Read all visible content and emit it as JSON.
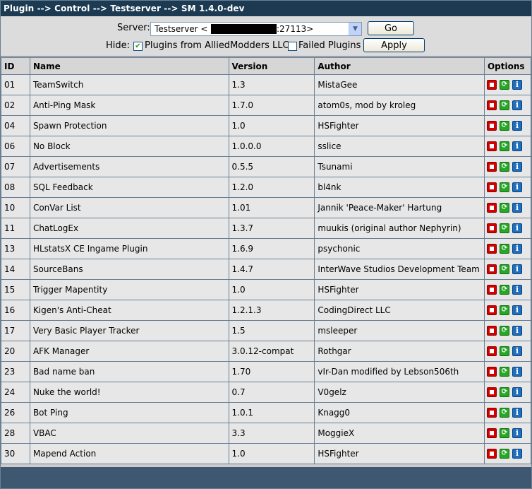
{
  "title": "Plugin --> Control --> Testserver --> SM 1.4.0-dev",
  "controls": {
    "server_label": "Server:",
    "server_value_prefix": "Testserver <",
    "server_value_suffix": ":27113>",
    "go_label": "Go",
    "hide_label": "Hide:",
    "hide_allied_label": "Plugins from AlliedModders LLC",
    "hide_allied_checked": true,
    "hide_failed_label": "Failed Plugins",
    "hide_failed_checked": false,
    "apply_label": "Apply"
  },
  "table": {
    "headers": [
      "ID",
      "Name",
      "Version",
      "Author",
      "Options"
    ],
    "rows": [
      {
        "id": "01",
        "name": "TeamSwitch",
        "version": "1.3",
        "author": "MistaGee"
      },
      {
        "id": "02",
        "name": "Anti-Ping Mask",
        "version": "1.7.0",
        "author": "atom0s, mod by kroleg"
      },
      {
        "id": "04",
        "name": "Spawn Protection",
        "version": "1.0",
        "author": "HSFighter"
      },
      {
        "id": "06",
        "name": "No Block",
        "version": "1.0.0.0",
        "author": "sslice"
      },
      {
        "id": "07",
        "name": "Advertisements",
        "version": "0.5.5",
        "author": "Tsunami"
      },
      {
        "id": "08",
        "name": "SQL Feedback",
        "version": "1.2.0",
        "author": "bl4nk"
      },
      {
        "id": "10",
        "name": "ConVar List",
        "version": "1.01",
        "author": "Jannik 'Peace-Maker' Hartung"
      },
      {
        "id": "11",
        "name": "ChatLogEx",
        "version": "1.3.7",
        "author": "muukis (original author Nephyrin)"
      },
      {
        "id": "13",
        "name": "HLstatsX CE Ingame Plugin",
        "version": "1.6.9",
        "author": "psychonic"
      },
      {
        "id": "14",
        "name": "SourceBans",
        "version": "1.4.7",
        "author": "InterWave Studios Development Team"
      },
      {
        "id": "15",
        "name": "Trigger Mapentity",
        "version": "1.0",
        "author": "HSFighter"
      },
      {
        "id": "16",
        "name": "Kigen's Anti-Cheat",
        "version": "1.2.1.3",
        "author": "CodingDirect LLC"
      },
      {
        "id": "17",
        "name": "Very Basic Player Tracker",
        "version": "1.5",
        "author": "msleeper"
      },
      {
        "id": "20",
        "name": "AFK Manager",
        "version": "3.0.12-compat",
        "author": "Rothgar"
      },
      {
        "id": "23",
        "name": "Bad name ban",
        "version": "1.70",
        "author": "vIr-Dan modified by Lebson506th"
      },
      {
        "id": "24",
        "name": "Nuke the world!",
        "version": "0.7",
        "author": "V0gelz"
      },
      {
        "id": "26",
        "name": "Bot Ping",
        "version": "1.0.1",
        "author": "Knagg0"
      },
      {
        "id": "28",
        "name": "VBAC",
        "version": "3.3",
        "author": "MoggieX"
      },
      {
        "id": "30",
        "name": "Mapend Action",
        "version": "1.0",
        "author": "HSFighter"
      }
    ],
    "option_icons": [
      "stop-icon",
      "reload-icon",
      "info-icon"
    ]
  },
  "colors": {
    "title_bg": "#1c3a52",
    "stop": "#d40000",
    "reload": "#26a826",
    "info": "#1e6fc0"
  }
}
